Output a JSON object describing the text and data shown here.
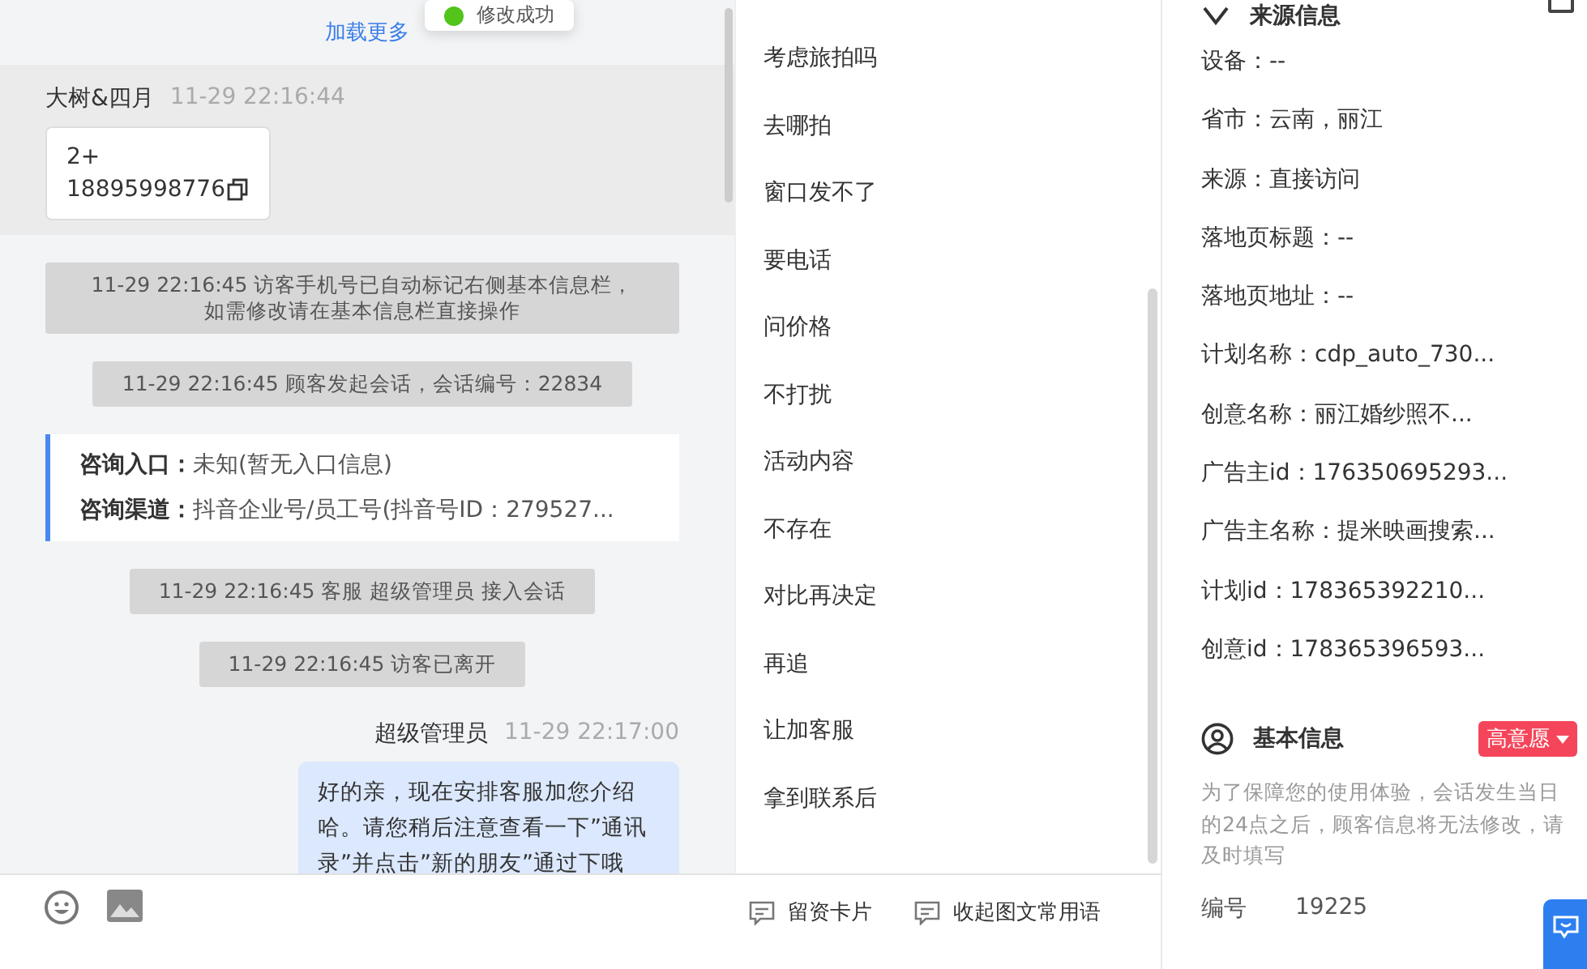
{
  "toast": {
    "text": "修改成功"
  },
  "chat": {
    "load_more": "加载更多",
    "messages": [
      {
        "kind": "visitor",
        "sender": "大树&四月",
        "time": "11-29 22:16:44",
        "lines": [
          "2+",
          "18895998776"
        ]
      },
      {
        "kind": "system",
        "lines": [
          "11-29 22:16:45 访客手机号已自动标记右侧基本信息栏，",
          "如需修改请在基本信息栏直接操作"
        ]
      },
      {
        "kind": "system",
        "lines": [
          "11-29 22:16:45 顾客发起会话，会话编号：22834"
        ]
      },
      {
        "kind": "entry",
        "fields": [
          {
            "label": "咨询入口：",
            "value": "未知(暂无入口信息)"
          },
          {
            "label": "咨询渠道：",
            "value": "抖音企业号/员工号(抖音号ID：279527..."
          }
        ]
      },
      {
        "kind": "system",
        "lines": [
          "11-29 22:16:45 客服 超级管理员 接入会话"
        ]
      },
      {
        "kind": "system",
        "lines": [
          "11-29 22:16:45 访客已离开"
        ]
      },
      {
        "kind": "agent",
        "sender": "超级管理员",
        "time": "11-29 22:17:00",
        "text": "好的亲，现在安排客服加您介绍哈。请您稍后注意查看一下”通讯录”并点击”新的朋友”通过下哦"
      }
    ]
  },
  "composer": {
    "buttons": [
      {
        "label": "留资卡片"
      },
      {
        "label": "收起图文常用语"
      }
    ]
  },
  "phrases": [
    "考虑旅拍吗",
    "去哪拍",
    "窗口发不了",
    "要电话",
    "问价格",
    "不打扰",
    "活动内容",
    "不存在",
    "对比再决定",
    "再追",
    "让加客服",
    "拿到联系后"
  ],
  "source_info": {
    "title": "来源信息",
    "rows": [
      "设备：--",
      "省市：云南，丽江",
      "来源：直接访问",
      "落地页标题：--",
      "落地页地址：--",
      "计划名称：cdp_auto_730...",
      "创意名称：丽江婚纱照不...",
      "广告主id：176350695293...",
      "广告主名称：提米映画搜索...",
      "计划id：178365392210...",
      "创意id：178365396593..."
    ]
  },
  "basic_info": {
    "title": "基本信息",
    "intent_tag": "高意愿",
    "notice": "为了保障您的使用体验，会话发生当日的24点之后，顾客信息将无法修改，请及时填写",
    "fields": [
      {
        "label": "编号",
        "value": "19225"
      }
    ]
  }
}
